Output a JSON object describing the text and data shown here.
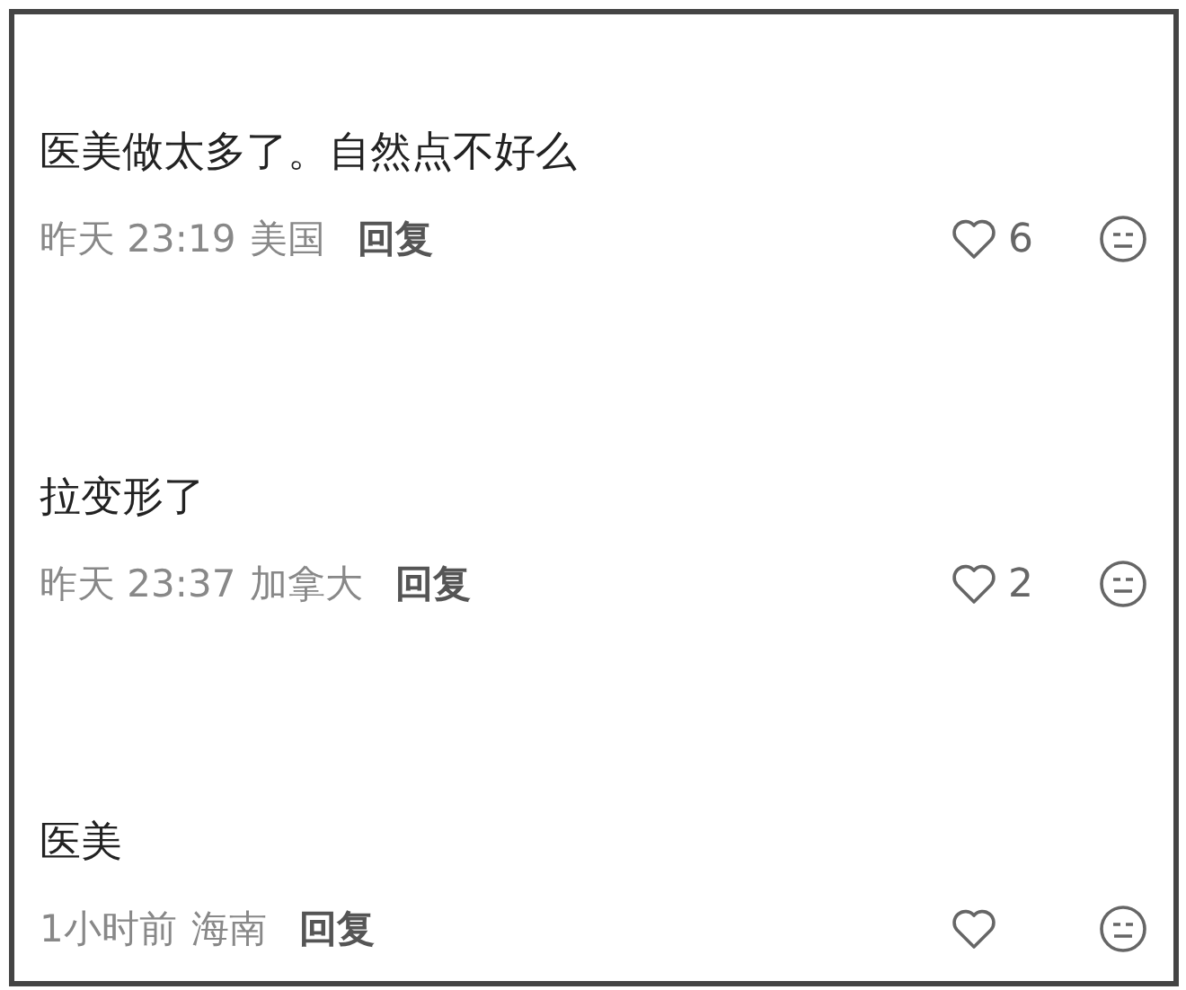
{
  "comments": [
    {
      "text": "医美做太多了。自然点不好么",
      "time": "昨天 23:19",
      "location": "美国",
      "reply": "回复",
      "likes": "6"
    },
    {
      "text": "拉变形了",
      "time": "昨天 23:37",
      "location": "加拿大",
      "reply": "回复",
      "likes": "2"
    },
    {
      "text": "医美",
      "time": "1小时前",
      "location": "海南",
      "reply": "回复"
    }
  ]
}
